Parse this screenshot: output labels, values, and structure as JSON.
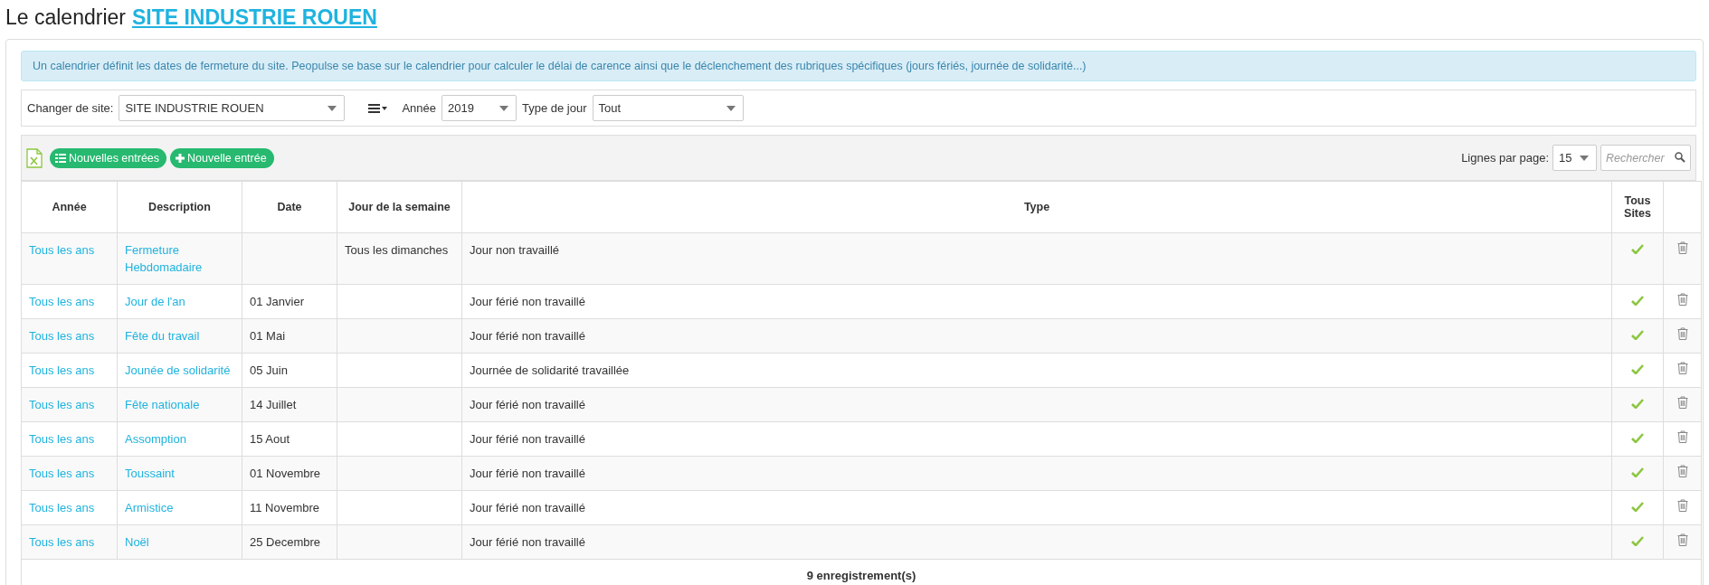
{
  "page_title": {
    "prefix": "Le calendrier",
    "link": "SITE INDUSTRIE ROUEN"
  },
  "info": "Un calendrier définit les dates de fermeture du site. Peopulse se base sur le calendrier pour calculer le délai de carence ainsi que le déclenchement des rubriques spécifiques (jours fériés, journée de solidarité...)",
  "filters": {
    "site_label": "Changer de site:",
    "site_value": "SITE INDUSTRIE ROUEN",
    "year_label": "Année",
    "year_value": "2019",
    "type_label": "Type de jour",
    "type_value": "Tout"
  },
  "toolbar": {
    "buttons": [
      {
        "kind": "list",
        "label": "Nouvelles entrées"
      },
      {
        "kind": "plus",
        "label": "Nouvelle entrée"
      }
    ],
    "rows_label": "Lignes par page:",
    "rows_value": "15",
    "search_placeholder": "Rechercher"
  },
  "table": {
    "columns": [
      "Année",
      "Description",
      "Date",
      "Jour de la semaine",
      "Type",
      "Tous Sites"
    ],
    "rows": [
      {
        "year": "Tous les ans",
        "description": "Fermeture Hebdomadaire",
        "date": "",
        "weekday": "Tous les dimanches",
        "type": "Jour non travaillé",
        "all_sites": true
      },
      {
        "year": "Tous les ans",
        "description": "Jour de l'an",
        "date": "01 Janvier",
        "weekday": "",
        "type": "Jour férié non travaillé",
        "all_sites": true
      },
      {
        "year": "Tous les ans",
        "description": "Fête du travail",
        "date": "01 Mai",
        "weekday": "",
        "type": "Jour férié non travaillé",
        "all_sites": true
      },
      {
        "year": "Tous les ans",
        "description": "Jounée de solidarité",
        "date": "05 Juin",
        "weekday": "",
        "type": "Journée de solidarité travaillée",
        "all_sites": true
      },
      {
        "year": "Tous les ans",
        "description": "Fête nationale",
        "date": "14 Juillet",
        "weekday": "",
        "type": "Jour férié non travaillé",
        "all_sites": true
      },
      {
        "year": "Tous les ans",
        "description": "Assomption",
        "date": "15 Aout",
        "weekday": "",
        "type": "Jour férié non travaillé",
        "all_sites": true
      },
      {
        "year": "Tous les ans",
        "description": "Toussaint",
        "date": "01 Novembre",
        "weekday": "",
        "type": "Jour férié non travaillé",
        "all_sites": true
      },
      {
        "year": "Tous les ans",
        "description": "Armistice",
        "date": "11 Novembre",
        "weekday": "",
        "type": "Jour férié non travaillé",
        "all_sites": true
      },
      {
        "year": "Tous les ans",
        "description": "Noël",
        "date": "25 Decembre",
        "weekday": "",
        "type": "Jour férié non travaillé",
        "all_sites": true
      }
    ],
    "footer": "9 enregistrement(s)"
  }
}
